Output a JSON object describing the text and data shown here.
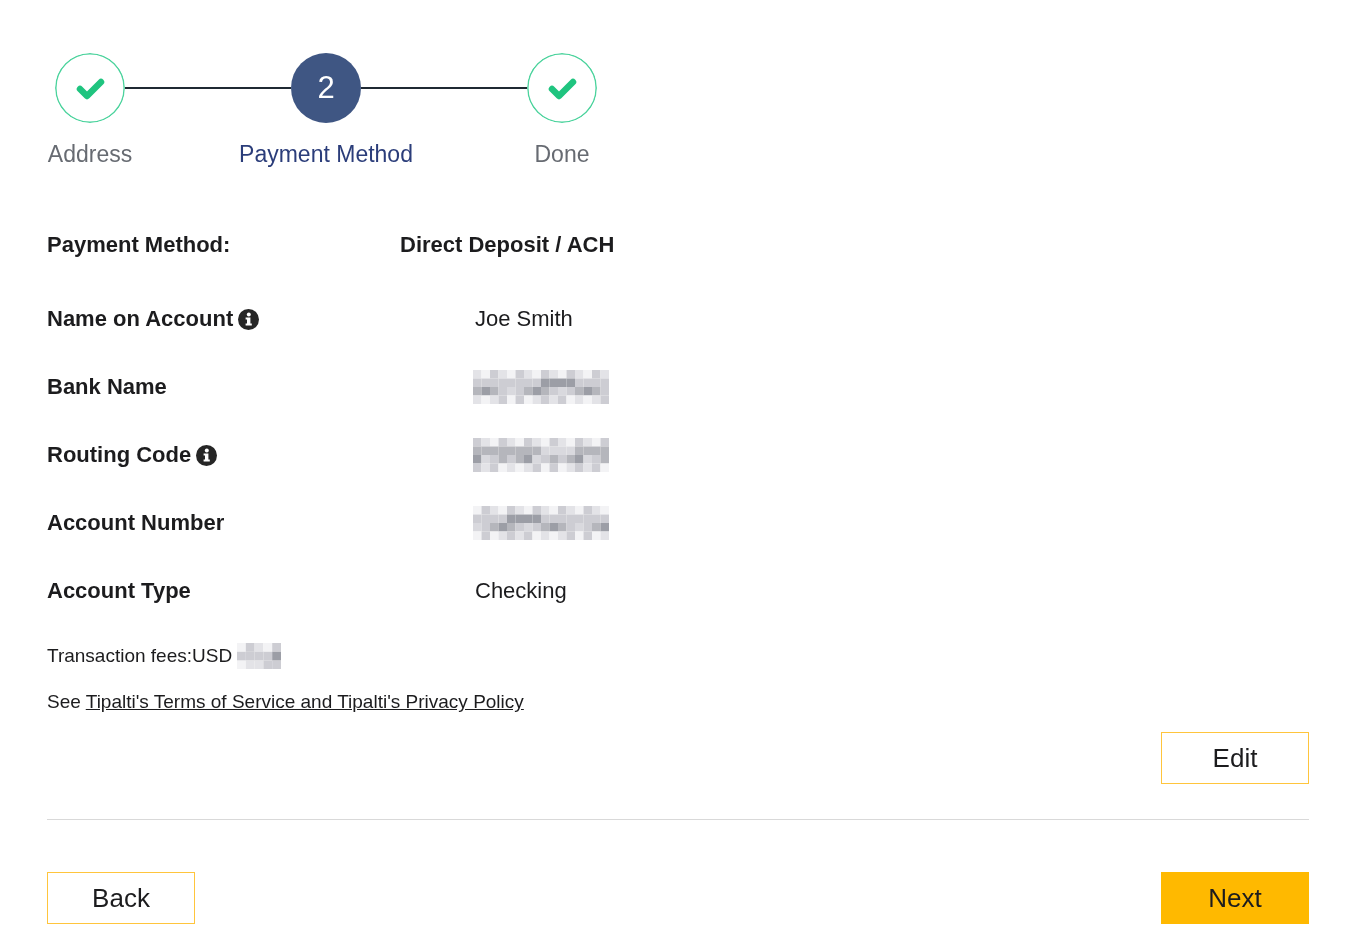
{
  "steps": [
    {
      "label": "Address",
      "completed": true,
      "current": false
    },
    {
      "label": "Payment Method",
      "completed": false,
      "current": true,
      "number": "2"
    },
    {
      "label": "Done",
      "completed": true,
      "current": false
    }
  ],
  "payment_method": {
    "label": "Payment Method:",
    "value": "Direct Deposit / ACH"
  },
  "details": [
    {
      "label": "Name on Account",
      "info": true,
      "kind": "text",
      "value": "Joe Smith"
    },
    {
      "label": "Bank Name",
      "info": false,
      "kind": "redacted"
    },
    {
      "label": "Routing Code",
      "info": true,
      "kind": "redacted"
    },
    {
      "label": "Account Number",
      "info": false,
      "kind": "redacted"
    },
    {
      "label": "Account Type",
      "info": false,
      "kind": "text",
      "value": "Checking"
    }
  ],
  "fees": {
    "label": "Transaction fees:USD",
    "amount_redacted": true
  },
  "terms": {
    "prefix": "See",
    "link": "Tipalti's Terms of Service and Tipalti's Privacy Policy"
  },
  "edit_button": {
    "label": "Edit"
  },
  "footer_buttons": [
    {
      "label": "Back",
      "kind": "outline"
    },
    {
      "label": "Next",
      "kind": "filled"
    }
  ]
}
